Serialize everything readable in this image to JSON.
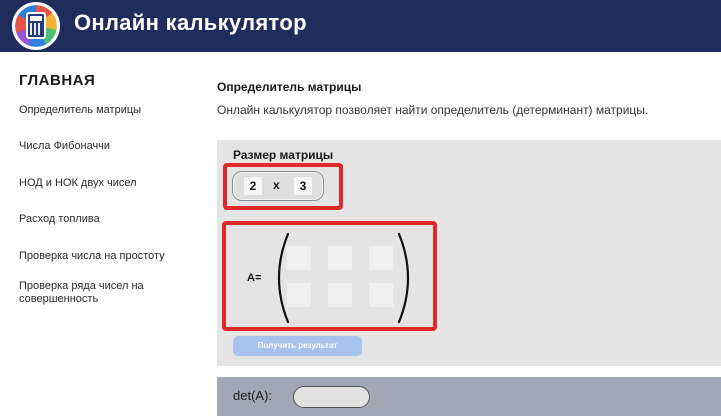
{
  "header": {
    "title": "Онлайн калькулятор"
  },
  "sidebar": {
    "heading": "ГЛАВНАЯ",
    "items": [
      {
        "label": "Определитель матрицы"
      },
      {
        "label": "Числа Фибоначчи"
      },
      {
        "label": "НОД и НОК двух чисел"
      },
      {
        "label": "Расход топлива"
      },
      {
        "label": "Проверка числа на простоту"
      },
      {
        "label": "Проверка ряда чисел на совершенность"
      }
    ]
  },
  "main": {
    "title": "Определитель матрицы",
    "description": "Онлайн калькулятор позволяет найти определитель (детерминант) матрицы.",
    "size_label": "Размер матрицы",
    "rows": "2",
    "times": "x",
    "cols": "3",
    "matrix_label": "A=",
    "button_label": "Получить результат",
    "det_label": "det(A):"
  },
  "colors": {
    "header_bg": "#1f2d5c",
    "panel_bg": "#e4e4e4",
    "highlight": "#e02a2a",
    "button_bg": "#a8c2ee",
    "result_bar_bg": "#a3a7b5"
  }
}
